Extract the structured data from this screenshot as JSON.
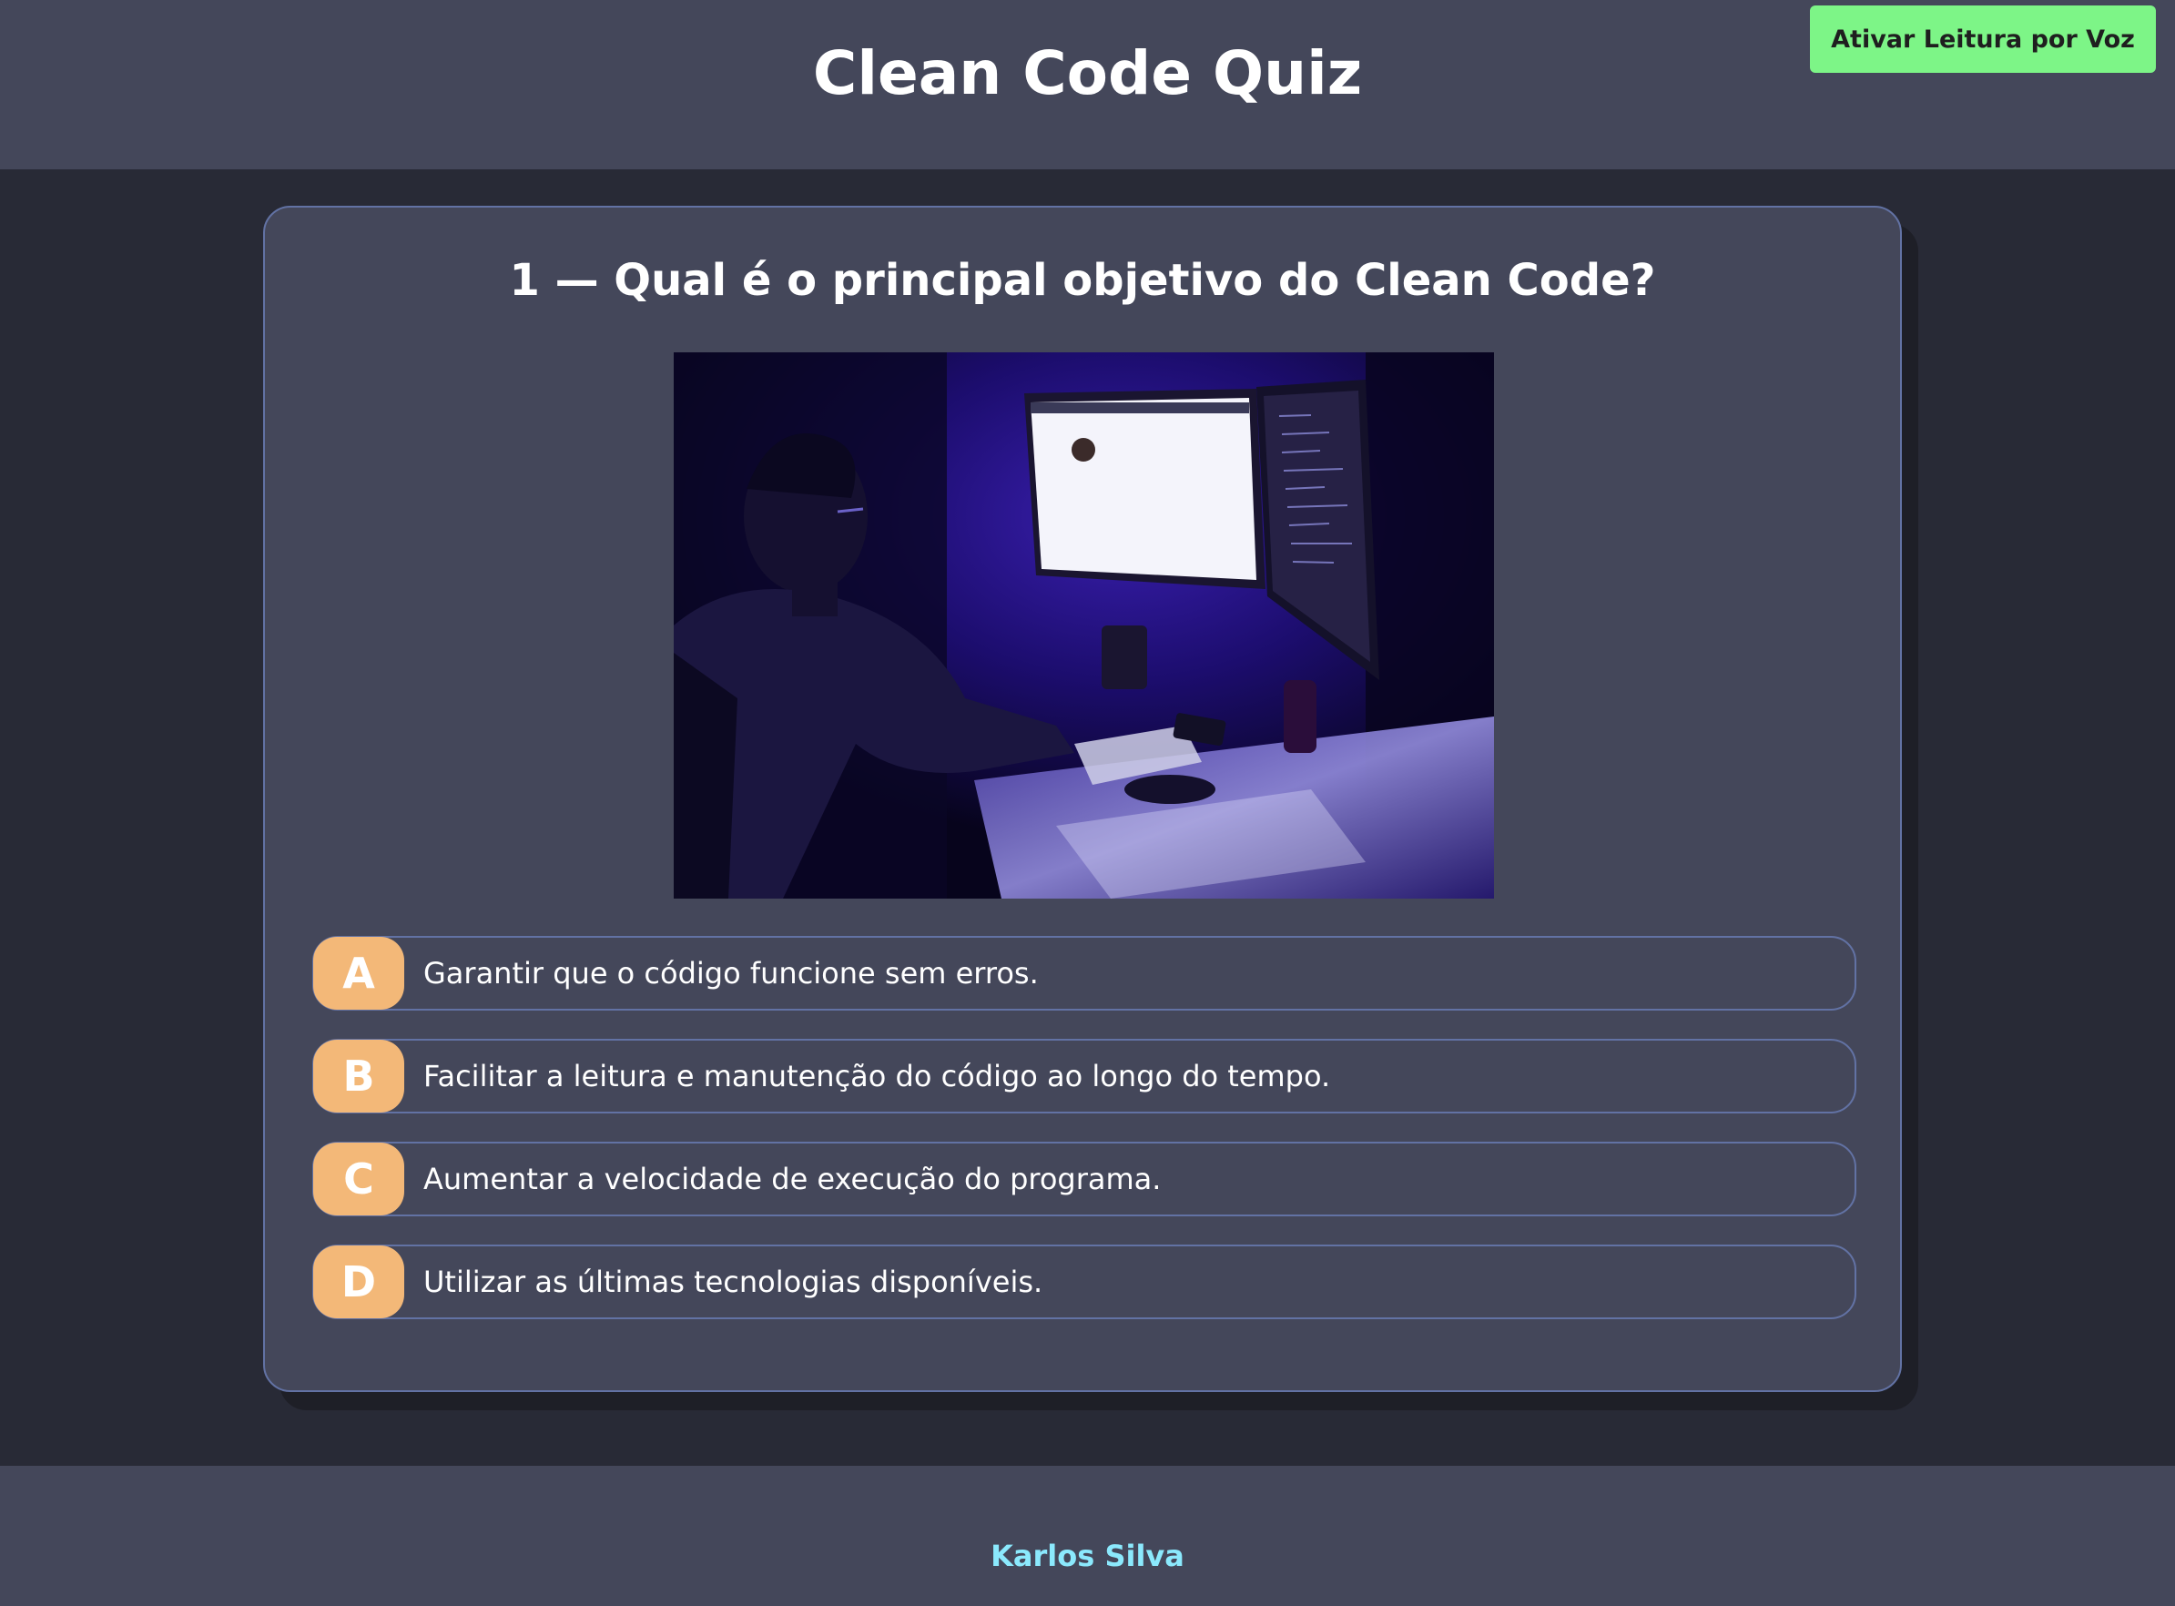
{
  "header": {
    "title": "Clean Code Quiz",
    "voice_button_label": "Ativar Leitura por Voz"
  },
  "quiz": {
    "question": "1 — Qual é o principal objetivo do Clean Code?",
    "image": "developer-at-night-desk-photo",
    "options": [
      {
        "letter": "A",
        "text": "Garantir que o código funcione sem erros."
      },
      {
        "letter": "B",
        "text": "Facilitar a leitura e manutenção do código ao longo do tempo."
      },
      {
        "letter": "C",
        "text": "Aumentar a velocidade de execução do programa."
      },
      {
        "letter": "D",
        "text": "Utilizar as últimas tecnologias disponíveis."
      }
    ]
  },
  "footer": {
    "author": "Karlos Silva"
  },
  "colors": {
    "background": "#282a36",
    "panel": "#44475a",
    "border": "#6272a4",
    "accent_button": "#7df587",
    "option_letter": "#f3b878",
    "author_link": "#8be9fd"
  }
}
